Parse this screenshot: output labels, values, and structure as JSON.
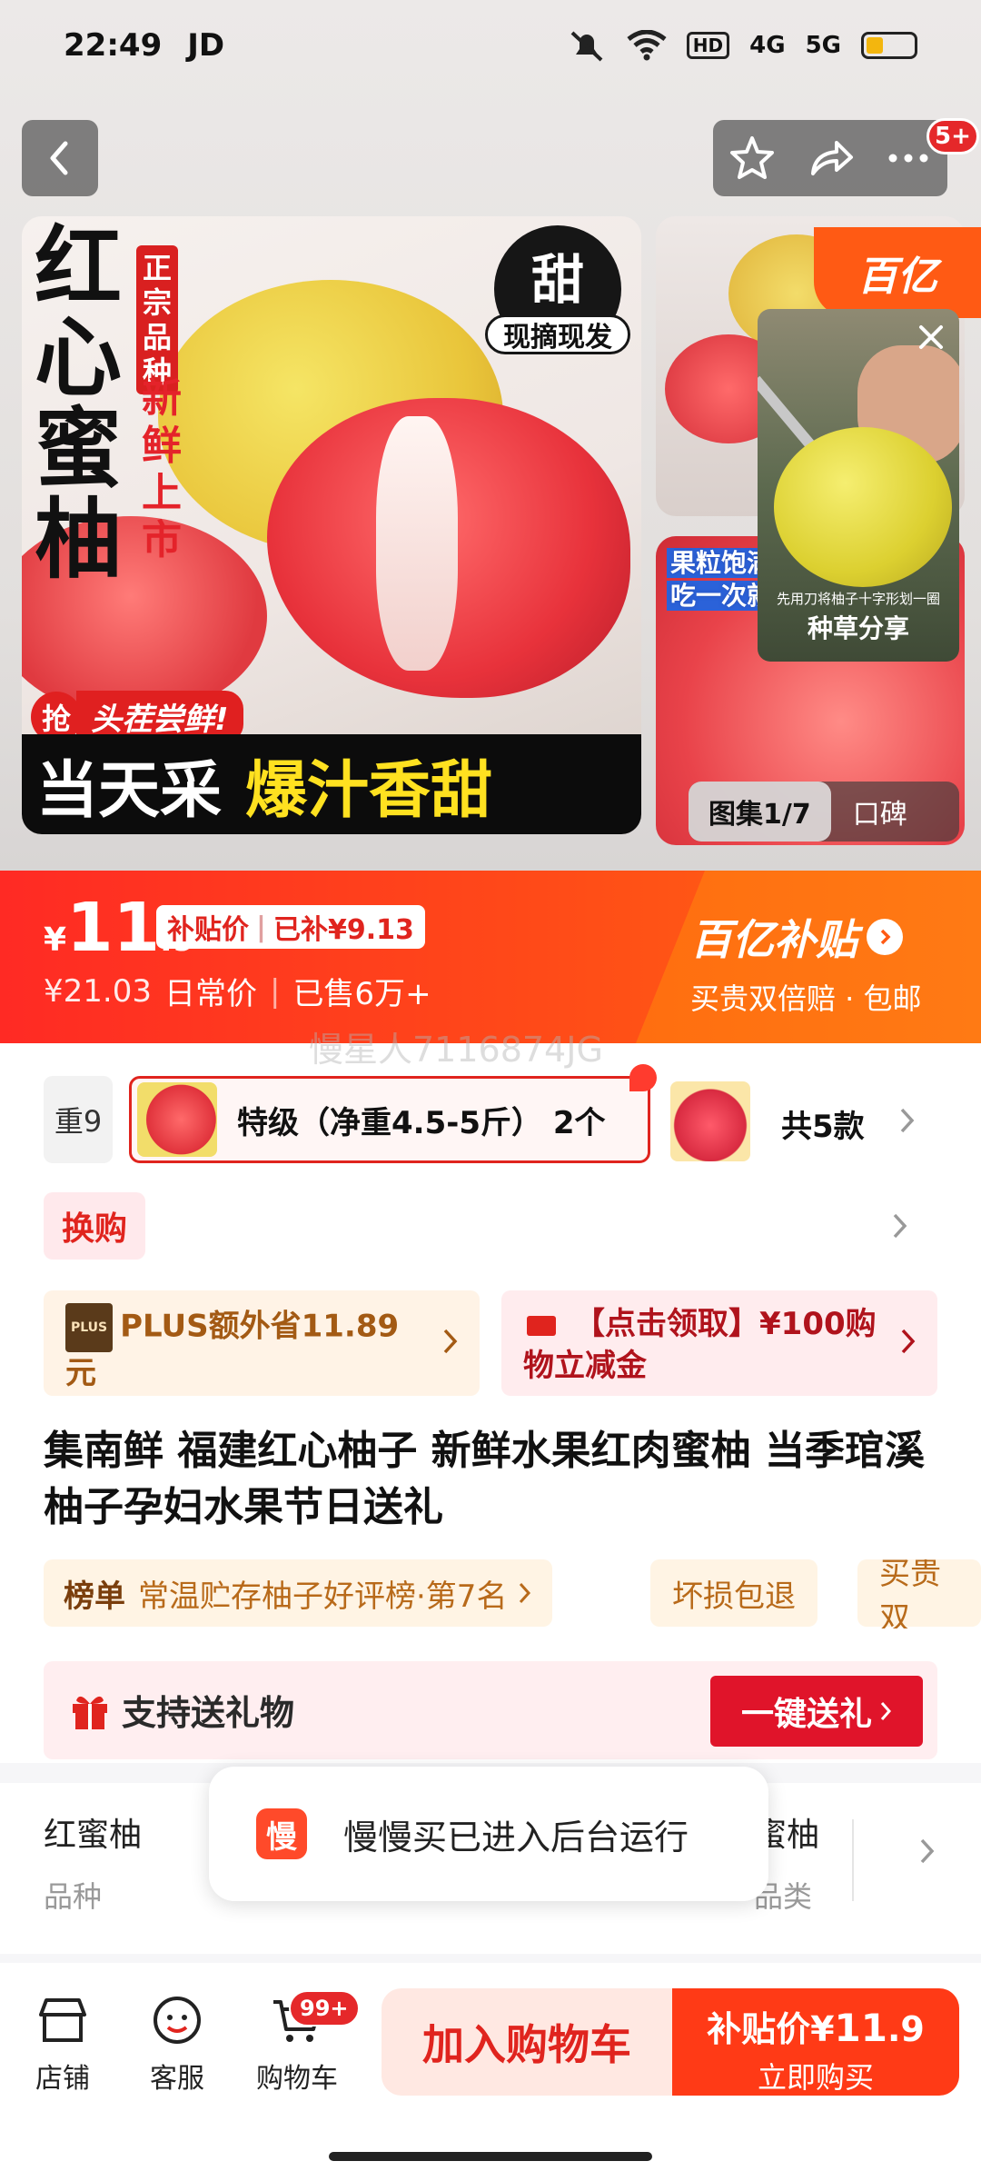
{
  "status": {
    "time": "22:49",
    "carrier": "JD",
    "icons": [
      "mute-icon",
      "wifi-icon",
      "hd-icon",
      "signal-4g-icon",
      "signal-5g-icon",
      "battery-icon"
    ],
    "hd": "HD",
    "net1": "4G",
    "net2": "5G"
  },
  "header": {
    "more_badge": "5+"
  },
  "gallery": {
    "main": {
      "big_title": "红心蜜柚",
      "vertical_tag": "正宗品种",
      "fresh": "新鲜上市",
      "sweet": "甜",
      "sweet_sub": "现摘现发",
      "grab": "抢",
      "first_taste": "头茬尝鲜!",
      "band_white": "当天采",
      "band_yellow": "爆汁香甜"
    },
    "side2_text": [
      "果粒饱满",
      "吃一次就"
    ],
    "yizhi_badge": "百亿",
    "video": {
      "subtitle": "先用刀将柚子十字形划一圈",
      "label": "种草分享"
    },
    "counter": "图集1/7",
    "reviews": "口碑"
  },
  "price": {
    "currency": "¥",
    "integer": "11",
    "decimal": ".9",
    "subsidy_label": "补贴价",
    "subsidy_amount": "已补¥9.13",
    "original": "¥21.03",
    "original_label": "日常价",
    "sold": "已售6万+",
    "yizhi_title": "百亿补贴",
    "yizhi_sub": "买贵双倍赔 · 包邮",
    "watermark": "慢星人7116874JG"
  },
  "sku": {
    "prev_fragment": "重9",
    "active": "特级（净重4.5-5斤） 2个",
    "count": "共5款"
  },
  "swap": {
    "label": "换购"
  },
  "promos": {
    "plus_logo": "PLUS",
    "plus": "PLUS额外省11.89元",
    "coupon": "【点击领取】¥100购物立减金"
  },
  "product_title": "集南鲜 福建红心柚子 新鲜水果红肉蜜柚 当季琯溪柚子孕妇水果节日送礼",
  "tags": {
    "rank_label": "榜单",
    "rank_desc": "常温贮存柚子好评榜·第7名",
    "tag2": "坏损包退",
    "tag3": "买贵双"
  },
  "gift": {
    "label": "支持送礼物",
    "button": "一键送礼"
  },
  "attrs": [
    {
      "value": "红蜜柚",
      "key": "品种"
    },
    {
      "value": "蜜柚",
      "key": "品类"
    }
  ],
  "toast": {
    "logo": "慢",
    "message": "慢慢买已进入后台运行"
  },
  "bottom": {
    "store": "店铺",
    "service": "客服",
    "cart": "购物车",
    "cart_badge": "99+",
    "add_cart": "加入购物车",
    "buy_price_label": "补贴价¥",
    "buy_price_int": "11",
    "buy_price_dec": ".9",
    "buy_now": "立即购买"
  },
  "colors": {
    "accent": "#e0241e",
    "orange": "#ff5a14",
    "subsidy_red": "#ff2a24"
  }
}
